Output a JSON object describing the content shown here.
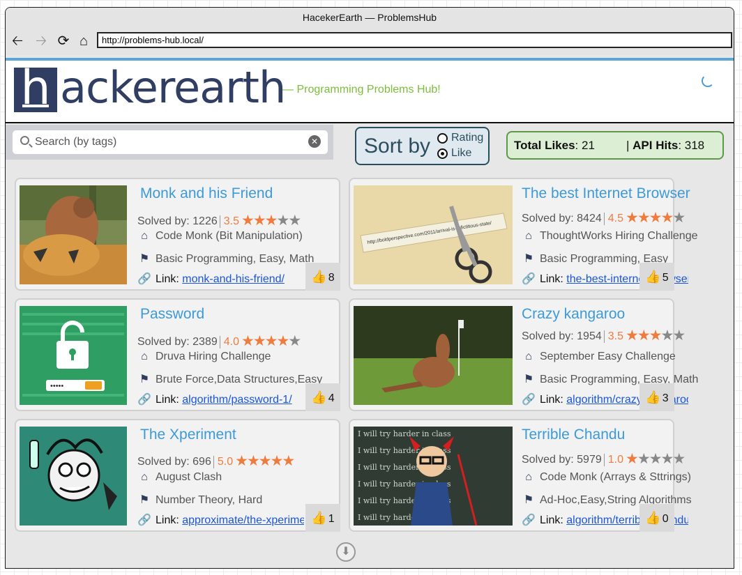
{
  "window": {
    "title": "HacekerEarth — ProblemsHub"
  },
  "browser": {
    "url": "http://problems-hub.local/",
    "back_icon": "back-arrow-icon",
    "forward_icon": "forward-arrow-icon",
    "reload_icon": "reload-icon",
    "home_icon": "home-icon"
  },
  "header": {
    "logo_letter": "h",
    "logo_text": "ackerearth",
    "tagline": "— Programming Problems Hub!",
    "brand_color": "#2f3e62",
    "accent_green": "#7cbd3b"
  },
  "search": {
    "placeholder": "Search (by tags)"
  },
  "sort": {
    "label": "Sort by",
    "options": [
      "Rating",
      "Like"
    ],
    "selected": "Like"
  },
  "stats": {
    "likes_label": "Total Likes",
    "likes_value": ": 21",
    "api_label": "API Hits",
    "api_value": ": 318"
  },
  "labels": {
    "solved_by": "Solved by: ",
    "link": "Link: "
  },
  "problems": [
    {
      "title": "Monk and his Friend",
      "solved": "1226",
      "rating": "3.5",
      "rating_value": 3.5,
      "contest": "Code Monk (Bit Manipulation)",
      "tags": "Basic Programming, Easy, Math",
      "link": "monk-and-his-friend/",
      "likes": "8"
    },
    {
      "title": "The best Internet Browser",
      "solved": "8424",
      "rating": "4.5",
      "rating_value": 4.5,
      "contest": "ThoughtWorks Hiring Challenge",
      "tags": "Basic Programming, Easy",
      "link": "the-best-internet-browser/",
      "likes": "5"
    },
    {
      "title": "Password",
      "solved": "2389",
      "rating": "4.0",
      "rating_value": 4.0,
      "contest": "Druva Hiring Challenge",
      "tags": "Brute Force,Data Structures,Easy",
      "link": "algorithm/password-1/",
      "likes": "4"
    },
    {
      "title": "Crazy kangaroo",
      "solved": "1954",
      "rating": "3.5",
      "rating_value": 3.5,
      "contest": "September Easy Challenge",
      "tags": "Basic Programming, Easy, Math",
      "link": "algorithm/crazy-kangaroo/",
      "likes": "3"
    },
    {
      "title": "The Xperiment",
      "solved": "696",
      "rating": "5.0",
      "rating_value": 5.0,
      "contest": "August Clash",
      "tags": "Number Theory, Hard",
      "link": "approximate/the-xperiment/",
      "likes": "1"
    },
    {
      "title": "Terrible Chandu",
      "solved": "5979",
      "rating": "1.0",
      "rating_value": 1.0,
      "contest": "Code Monk (Arrays & Sttrings)",
      "tags": "Ad-Hoc,Easy,String Algorithms",
      "link": "algorithm/terrible-chandu/",
      "likes": "0"
    }
  ],
  "thumbnail_text": {
    "browser_url": "http://boldperspective.com/2011/arrival-is-a-fictitious-state/",
    "password_dots": "•••••",
    "chalk_line": "I will try harder in class"
  },
  "load_more_icon": "arrow-down-circle-icon"
}
